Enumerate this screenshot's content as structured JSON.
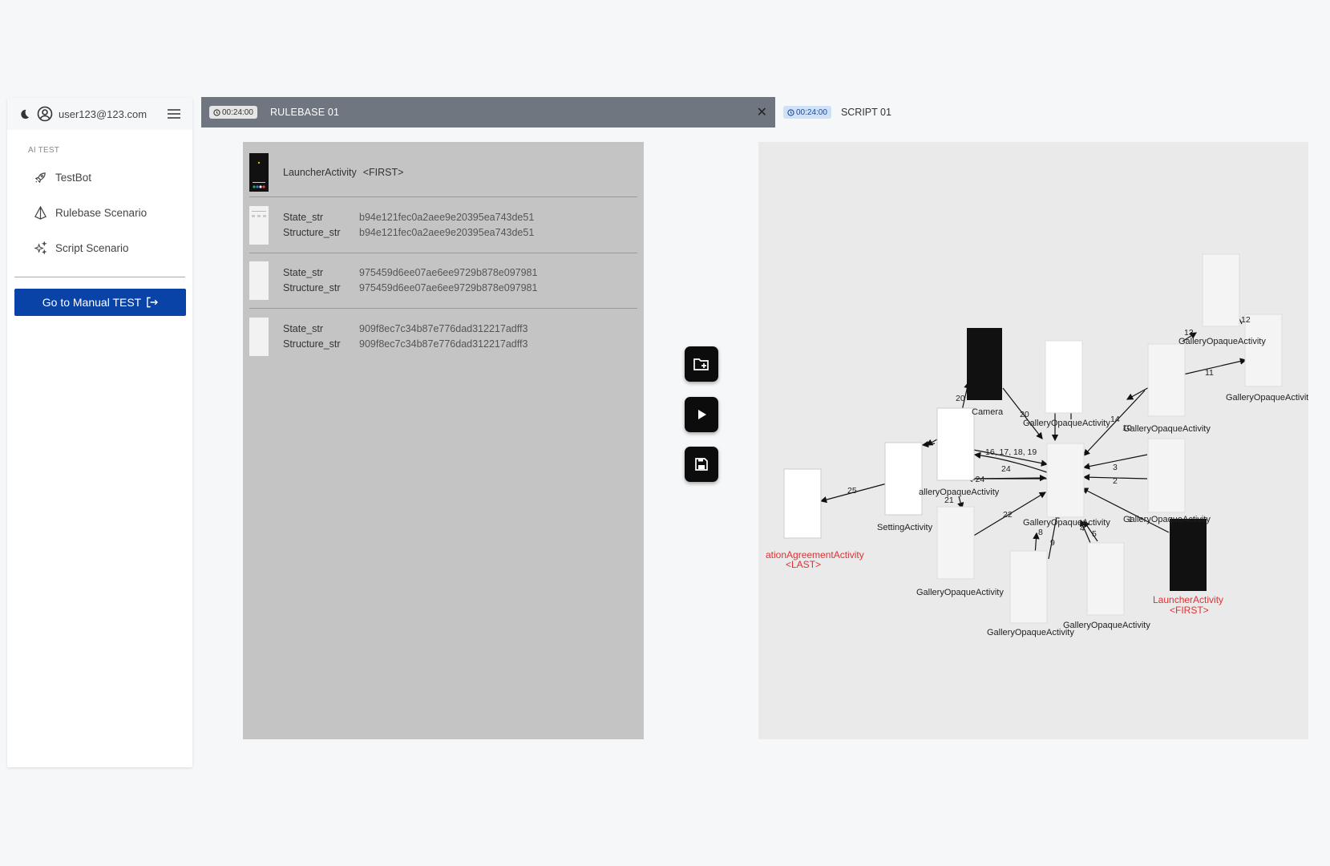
{
  "sidebar": {
    "email": "user123@123.com",
    "section_label": "AI TEST",
    "items": [
      {
        "label": "TestBot",
        "icon": "rocket-icon"
      },
      {
        "label": "Rulebase Scenario",
        "icon": "cone-icon"
      },
      {
        "label": "Script Scenario",
        "icon": "sparkles-icon"
      }
    ],
    "manual_button": "Go to Manual TEST"
  },
  "tabs": [
    {
      "timer": "00:24:00",
      "title": "RULEBASE 01",
      "active": true
    },
    {
      "timer": "00:24:00",
      "title": "SCRIPT 01",
      "active": false
    }
  ],
  "states": {
    "first": {
      "name": "LauncherActivity",
      "tag": "<FIRST>"
    },
    "key_state": "State_str",
    "key_structure": "Structure_str",
    "rows": [
      {
        "state": "b94e121fec0a2aee9e20395ea743de51",
        "structure": "b94e121fec0a2aee9e20395ea743de51"
      },
      {
        "state": "975459d6ee07ae6ee9729b878e097981",
        "structure": "975459d6ee07ae6ee9729b878e097981"
      },
      {
        "state": "909f8ec7c34b87e776dad312217adff3",
        "structure": "909f8ec7c34b87e776dad312217adff3"
      }
    ]
  },
  "graph": {
    "nodes": {
      "camera": "Camera",
      "gallery": "GalleryOpaqueActivity",
      "gallery_cut_left": "alleryOpaqueActivity",
      "gallery_cut_right": "GalleryOpaqueActivit",
      "gallery_overlap": "GalleryOpaqueActivity",
      "setting": "SettingActivity",
      "agreement": "ationAgreementActivity",
      "last_tag": "<LAST>",
      "launcher": "LauncherActivity",
      "first_tag": "<FIRST>"
    },
    "edges": {
      "e25": "25",
      "e21": "21",
      "e24a": "24",
      "e24b": "-24",
      "e16": "16, 17, 18, 19",
      "e20a": "20",
      "e20b": "20",
      "e22": "22",
      "e8": "8",
      "e9": "9",
      "e4": "4",
      "e5": "5",
      "e1": "1",
      "e2": "2",
      "e3": "3",
      "e14": "14",
      "e10": "10",
      "e11": "11",
      "e13": "13",
      "e12": "12"
    }
  }
}
